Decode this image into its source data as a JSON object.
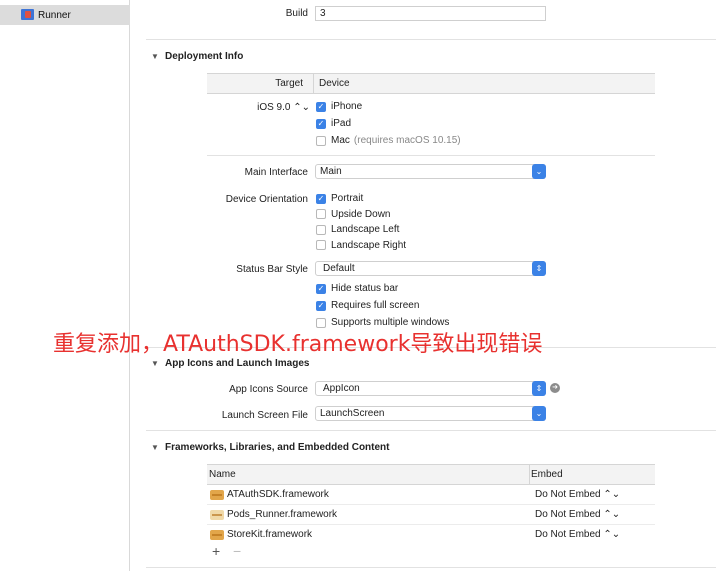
{
  "sidebar": {
    "project_name": "Runner"
  },
  "build": {
    "label": "Build",
    "value": "3"
  },
  "deployment": {
    "title": "Deployment Info",
    "target_header": "Target",
    "device_header": "Device",
    "ios_version": "iOS 9.0 ⌃⌄",
    "devices": [
      {
        "label": "iPhone",
        "checked": true,
        "note": ""
      },
      {
        "label": "iPad",
        "checked": true,
        "note": ""
      },
      {
        "label": "Mac",
        "checked": false,
        "note": "(requires macOS 10.15)"
      }
    ],
    "main_interface_label": "Main Interface",
    "main_interface_value": "Main",
    "orientation_label": "Device Orientation",
    "orientations": [
      {
        "label": "Portrait",
        "checked": true
      },
      {
        "label": "Upside Down",
        "checked": false
      },
      {
        "label": "Landscape Left",
        "checked": false
      },
      {
        "label": "Landscape Right",
        "checked": false
      }
    ],
    "status_bar_label": "Status Bar Style",
    "status_bar_value": "Default",
    "status_options": [
      {
        "label": "Hide status bar",
        "checked": true
      },
      {
        "label": "Requires full screen",
        "checked": true
      },
      {
        "label": "Supports multiple windows",
        "checked": false
      }
    ]
  },
  "icons": {
    "title": "App Icons and Launch Images",
    "app_icons_label": "App Icons Source",
    "app_icons_value": "AppIcon",
    "launch_label": "Launch Screen File",
    "launch_value": "LaunchScreen"
  },
  "frameworks": {
    "title": "Frameworks, Libraries, and Embedded Content",
    "col_name": "Name",
    "col_embed": "Embed",
    "rows": [
      {
        "name": "ATAuthSDK.framework",
        "embed": "Do Not Embed ⌃⌄"
      },
      {
        "name": "Pods_Runner.framework",
        "embed": "Do Not Embed ⌃⌄"
      },
      {
        "name": "StoreKit.framework",
        "embed": "Do Not Embed ⌃⌄"
      }
    ],
    "add": "+",
    "remove": "−"
  },
  "annotation": "重复添加，ATAuthSDK.framework导致出现错误",
  "colors": {
    "accent": "#3b82e6",
    "annotation": "#e8312f"
  }
}
